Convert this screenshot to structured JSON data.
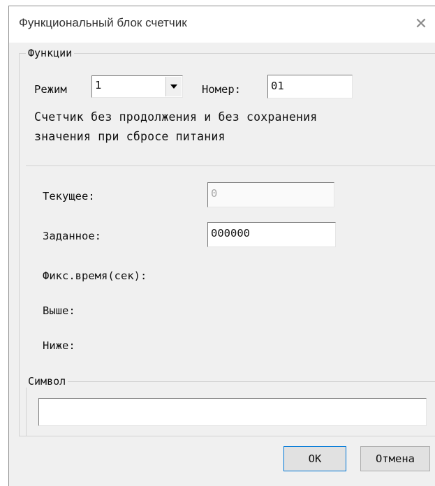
{
  "window": {
    "title": "Функциональный блок счетчик",
    "close_glyph": "✕"
  },
  "functions": {
    "legend": "Функции",
    "mode_label": "Режим",
    "mode_value": "1",
    "number_label": "Номер:",
    "number_value": "01",
    "description_line1": "Счетчик без продолжения и без сохранения",
    "description_line2": "значения при сбросе питания"
  },
  "params": {
    "current_label": "Текущее:",
    "current_value": "0",
    "setpoint_label": "Заданное:",
    "setpoint_value": "000000",
    "fixed_time_label": "Фикс.время(сек):",
    "above_label": "Выше:",
    "below_label": "Ниже:"
  },
  "symbol": {
    "legend": "Символ",
    "value": ""
  },
  "buttons": {
    "ok": "OK",
    "cancel": "Отмена"
  }
}
